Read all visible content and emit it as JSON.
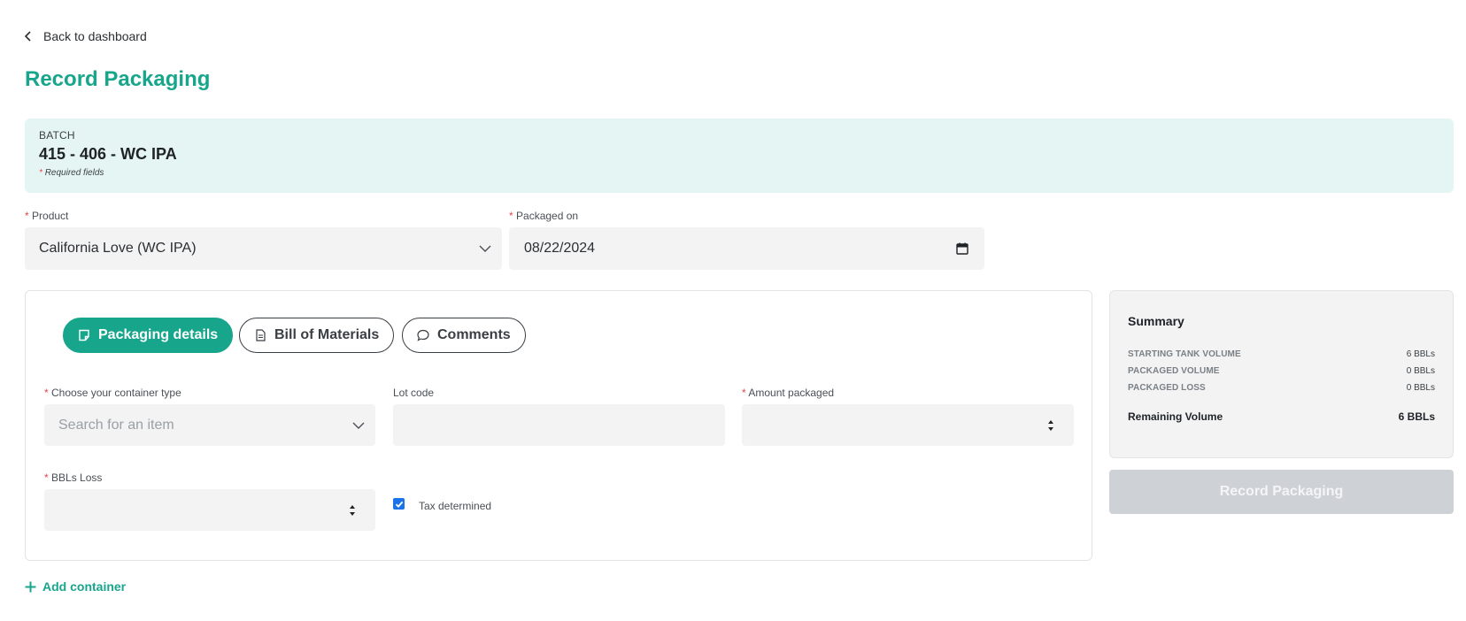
{
  "nav": {
    "back_label": "Back to dashboard"
  },
  "page": {
    "title": "Record Packaging"
  },
  "batch": {
    "label": "BATCH",
    "name": "415 - 406 - WC IPA",
    "required_note": "Required fields",
    "required_star": "*"
  },
  "form": {
    "product": {
      "label": "Product",
      "value": "California Love (WC IPA)"
    },
    "packaged_on": {
      "label": "Packaged on",
      "value": "08/22/2024"
    }
  },
  "tabs": [
    {
      "label": "Packaging details",
      "icon": "note-icon",
      "active": true
    },
    {
      "label": "Bill of Materials",
      "icon": "document-icon",
      "active": false
    },
    {
      "label": "Comments",
      "icon": "chat-bubble-icon",
      "active": false
    }
  ],
  "container": {
    "container_type": {
      "label": "Choose your container type",
      "placeholder": "Search for an item",
      "value": ""
    },
    "lot_code": {
      "label": "Lot code",
      "value": ""
    },
    "amount_packaged": {
      "label": "Amount packaged",
      "value": ""
    },
    "bbls_loss": {
      "label": "BBLs Loss",
      "value": ""
    },
    "tax_determined": {
      "label": "Tax determined",
      "checked": true
    }
  },
  "add_container_label": "Add container",
  "summary": {
    "title": "Summary",
    "rows": [
      {
        "label": "STARTING TANK VOLUME",
        "value": "6 BBLs"
      },
      {
        "label": "PACKAGED VOLUME",
        "value": "0 BBLs"
      },
      {
        "label": "PACKAGED LOSS",
        "value": "0 BBLs"
      }
    ],
    "remaining": {
      "label": "Remaining Volume",
      "value": "6 BBLs"
    }
  },
  "record_button_label": "Record Packaging",
  "colors": {
    "accent": "#17a58c",
    "batch_bg": "#e5f5f3",
    "required": "#e0484a",
    "disabled_button": "#ced1d5",
    "checkbox": "#1a73e8"
  }
}
